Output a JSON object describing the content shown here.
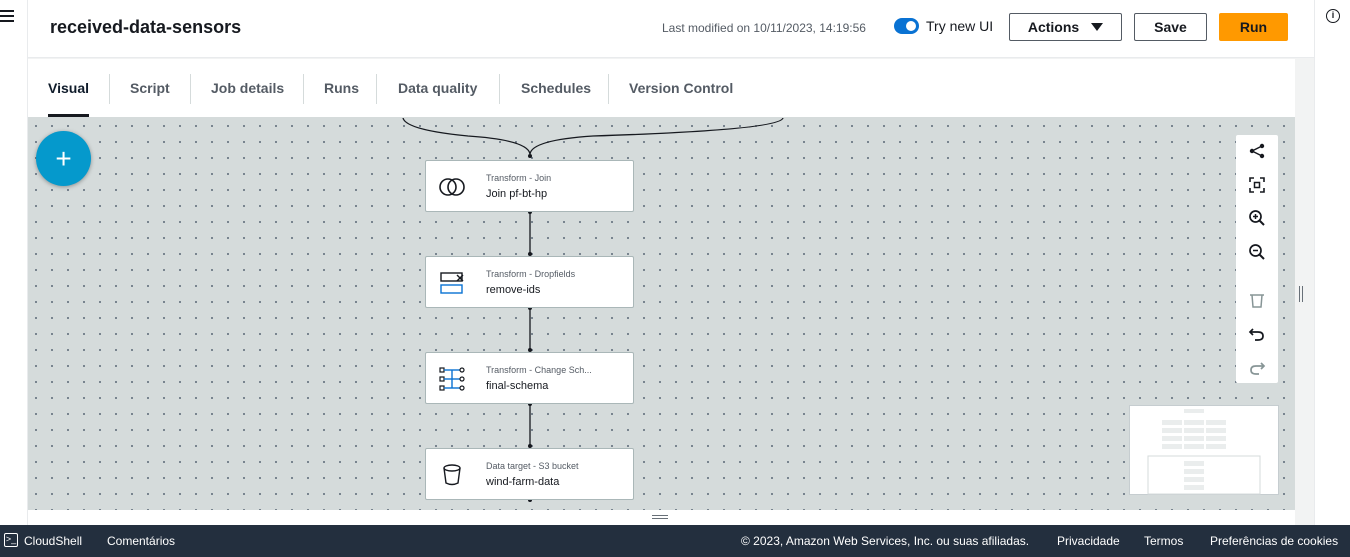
{
  "header": {
    "job_title": "received-data-sensors",
    "last_modified": "Last modified on 10/11/2023, 14:19:56",
    "toggle_label": "Try new UI",
    "actions_label": "Actions",
    "save_label": "Save",
    "run_label": "Run"
  },
  "tabs": [
    {
      "label": "Visual",
      "active": true
    },
    {
      "label": "Script"
    },
    {
      "label": "Job details"
    },
    {
      "label": "Runs"
    },
    {
      "label": "Data quality"
    },
    {
      "label": "Schedules"
    },
    {
      "label": "Version Control"
    }
  ],
  "canvas": {
    "add_button_icon": "+",
    "nodes": [
      {
        "type": "Transform - Join",
        "name": "Join pf-bt-hp",
        "icon": "join-icon"
      },
      {
        "type": "Transform - Dropfields",
        "name": "remove-ids",
        "icon": "drop-fields-icon"
      },
      {
        "type": "Transform - Change Sch...",
        "name": "final-schema",
        "icon": "change-schema-icon"
      },
      {
        "type": "Data target - S3 bucket",
        "name": "wind-farm-data",
        "icon": "s3-bucket-icon"
      }
    ],
    "tools": [
      "layout-icon",
      "fit-screen-icon",
      "zoom-in-icon",
      "zoom-out-icon",
      "delete-icon",
      "undo-icon",
      "redo-icon"
    ]
  },
  "footer": {
    "cloudshell": "CloudShell",
    "feedback": "Comentários",
    "copyright": "© 2023, Amazon Web Services, Inc. ou suas afiliadas.",
    "privacy": "Privacidade",
    "terms": "Termos",
    "cookies": "Preferências de cookies"
  },
  "colors": {
    "accent": "#0972d3",
    "run_button": "#ff9900",
    "add_button": "#0599cc",
    "footer_bg": "#232f3e",
    "canvas_bg": "#d5dbdb"
  }
}
